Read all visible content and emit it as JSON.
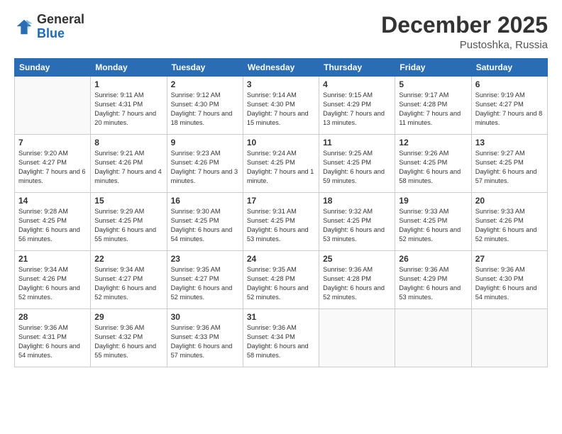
{
  "logo": {
    "general": "General",
    "blue": "Blue"
  },
  "title": "December 2025",
  "subtitle": "Pustoshka, Russia",
  "weekdays": [
    "Sunday",
    "Monday",
    "Tuesday",
    "Wednesday",
    "Thursday",
    "Friday",
    "Saturday"
  ],
  "weeks": [
    [
      {
        "day": "",
        "sunrise": "",
        "sunset": "",
        "daylight": ""
      },
      {
        "day": "1",
        "sunrise": "Sunrise: 9:11 AM",
        "sunset": "Sunset: 4:31 PM",
        "daylight": "Daylight: 7 hours and 20 minutes."
      },
      {
        "day": "2",
        "sunrise": "Sunrise: 9:12 AM",
        "sunset": "Sunset: 4:30 PM",
        "daylight": "Daylight: 7 hours and 18 minutes."
      },
      {
        "day": "3",
        "sunrise": "Sunrise: 9:14 AM",
        "sunset": "Sunset: 4:30 PM",
        "daylight": "Daylight: 7 hours and 15 minutes."
      },
      {
        "day": "4",
        "sunrise": "Sunrise: 9:15 AM",
        "sunset": "Sunset: 4:29 PM",
        "daylight": "Daylight: 7 hours and 13 minutes."
      },
      {
        "day": "5",
        "sunrise": "Sunrise: 9:17 AM",
        "sunset": "Sunset: 4:28 PM",
        "daylight": "Daylight: 7 hours and 11 minutes."
      },
      {
        "day": "6",
        "sunrise": "Sunrise: 9:19 AM",
        "sunset": "Sunset: 4:27 PM",
        "daylight": "Daylight: 7 hours and 8 minutes."
      }
    ],
    [
      {
        "day": "7",
        "sunrise": "Sunrise: 9:20 AM",
        "sunset": "Sunset: 4:27 PM",
        "daylight": "Daylight: 7 hours and 6 minutes."
      },
      {
        "day": "8",
        "sunrise": "Sunrise: 9:21 AM",
        "sunset": "Sunset: 4:26 PM",
        "daylight": "Daylight: 7 hours and 4 minutes."
      },
      {
        "day": "9",
        "sunrise": "Sunrise: 9:23 AM",
        "sunset": "Sunset: 4:26 PM",
        "daylight": "Daylight: 7 hours and 3 minutes."
      },
      {
        "day": "10",
        "sunrise": "Sunrise: 9:24 AM",
        "sunset": "Sunset: 4:25 PM",
        "daylight": "Daylight: 7 hours and 1 minute."
      },
      {
        "day": "11",
        "sunrise": "Sunrise: 9:25 AM",
        "sunset": "Sunset: 4:25 PM",
        "daylight": "Daylight: 6 hours and 59 minutes."
      },
      {
        "day": "12",
        "sunrise": "Sunrise: 9:26 AM",
        "sunset": "Sunset: 4:25 PM",
        "daylight": "Daylight: 6 hours and 58 minutes."
      },
      {
        "day": "13",
        "sunrise": "Sunrise: 9:27 AM",
        "sunset": "Sunset: 4:25 PM",
        "daylight": "Daylight: 6 hours and 57 minutes."
      }
    ],
    [
      {
        "day": "14",
        "sunrise": "Sunrise: 9:28 AM",
        "sunset": "Sunset: 4:25 PM",
        "daylight": "Daylight: 6 hours and 56 minutes."
      },
      {
        "day": "15",
        "sunrise": "Sunrise: 9:29 AM",
        "sunset": "Sunset: 4:25 PM",
        "daylight": "Daylight: 6 hours and 55 minutes."
      },
      {
        "day": "16",
        "sunrise": "Sunrise: 9:30 AM",
        "sunset": "Sunset: 4:25 PM",
        "daylight": "Daylight: 6 hours and 54 minutes."
      },
      {
        "day": "17",
        "sunrise": "Sunrise: 9:31 AM",
        "sunset": "Sunset: 4:25 PM",
        "daylight": "Daylight: 6 hours and 53 minutes."
      },
      {
        "day": "18",
        "sunrise": "Sunrise: 9:32 AM",
        "sunset": "Sunset: 4:25 PM",
        "daylight": "Daylight: 6 hours and 53 minutes."
      },
      {
        "day": "19",
        "sunrise": "Sunrise: 9:33 AM",
        "sunset": "Sunset: 4:25 PM",
        "daylight": "Daylight: 6 hours and 52 minutes."
      },
      {
        "day": "20",
        "sunrise": "Sunrise: 9:33 AM",
        "sunset": "Sunset: 4:26 PM",
        "daylight": "Daylight: 6 hours and 52 minutes."
      }
    ],
    [
      {
        "day": "21",
        "sunrise": "Sunrise: 9:34 AM",
        "sunset": "Sunset: 4:26 PM",
        "daylight": "Daylight: 6 hours and 52 minutes."
      },
      {
        "day": "22",
        "sunrise": "Sunrise: 9:34 AM",
        "sunset": "Sunset: 4:27 PM",
        "daylight": "Daylight: 6 hours and 52 minutes."
      },
      {
        "day": "23",
        "sunrise": "Sunrise: 9:35 AM",
        "sunset": "Sunset: 4:27 PM",
        "daylight": "Daylight: 6 hours and 52 minutes."
      },
      {
        "day": "24",
        "sunrise": "Sunrise: 9:35 AM",
        "sunset": "Sunset: 4:28 PM",
        "daylight": "Daylight: 6 hours and 52 minutes."
      },
      {
        "day": "25",
        "sunrise": "Sunrise: 9:36 AM",
        "sunset": "Sunset: 4:28 PM",
        "daylight": "Daylight: 6 hours and 52 minutes."
      },
      {
        "day": "26",
        "sunrise": "Sunrise: 9:36 AM",
        "sunset": "Sunset: 4:29 PM",
        "daylight": "Daylight: 6 hours and 53 minutes."
      },
      {
        "day": "27",
        "sunrise": "Sunrise: 9:36 AM",
        "sunset": "Sunset: 4:30 PM",
        "daylight": "Daylight: 6 hours and 54 minutes."
      }
    ],
    [
      {
        "day": "28",
        "sunrise": "Sunrise: 9:36 AM",
        "sunset": "Sunset: 4:31 PM",
        "daylight": "Daylight: 6 hours and 54 minutes."
      },
      {
        "day": "29",
        "sunrise": "Sunrise: 9:36 AM",
        "sunset": "Sunset: 4:32 PM",
        "daylight": "Daylight: 6 hours and 55 minutes."
      },
      {
        "day": "30",
        "sunrise": "Sunrise: 9:36 AM",
        "sunset": "Sunset: 4:33 PM",
        "daylight": "Daylight: 6 hours and 57 minutes."
      },
      {
        "day": "31",
        "sunrise": "Sunrise: 9:36 AM",
        "sunset": "Sunset: 4:34 PM",
        "daylight": "Daylight: 6 hours and 58 minutes."
      },
      {
        "day": "",
        "sunrise": "",
        "sunset": "",
        "daylight": ""
      },
      {
        "day": "",
        "sunrise": "",
        "sunset": "",
        "daylight": ""
      },
      {
        "day": "",
        "sunrise": "",
        "sunset": "",
        "daylight": ""
      }
    ]
  ]
}
